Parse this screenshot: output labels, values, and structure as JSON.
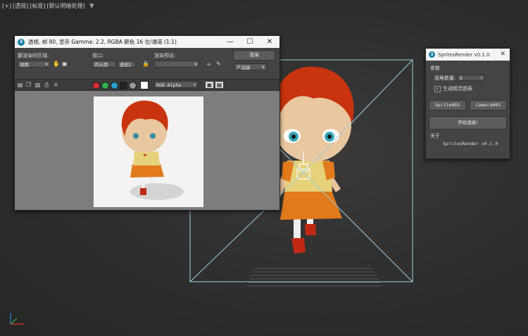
{
  "viewport": {
    "labels": [
      "[+]",
      "[透视]",
      "[标准]",
      "[默认明暗处理]"
    ],
    "filter_icon": "funnel-icon"
  },
  "frame_buffer": {
    "title": "透视, 帧 80, 显示 Gamma: 2.2, RGBA 颜色 16 位/通道 (1:1)",
    "area_label": "要渲染的区域:",
    "area_value": "视图",
    "viewport_label": "视口:",
    "viewport_value_1": "四元菜·",
    "viewport_value_2": "透视1",
    "preset_label": "渲染预设:",
    "preset_value": "",
    "render_button": "渲染",
    "quality_value": "产品级",
    "channel_value": "RGB Alpha"
  },
  "sprites_panel": {
    "title": "SpritesRender v0.1.0",
    "params_label": "参数",
    "view_count_label": "视角数量:",
    "view_count_value": "8",
    "checkbox_label": "生成精灵图表",
    "checkbox_checked": true,
    "sprite_button": "Sprite001",
    "camera_button": "Camera001",
    "start_button": "开始渲染!",
    "about_label": "关于",
    "about_text": "SpritesRender v0.1.0"
  },
  "colors": {
    "viewport_bg": "#2e2e2e",
    "frame_line": "#9fd0d8",
    "accent_blue": "#1b7fa6"
  }
}
